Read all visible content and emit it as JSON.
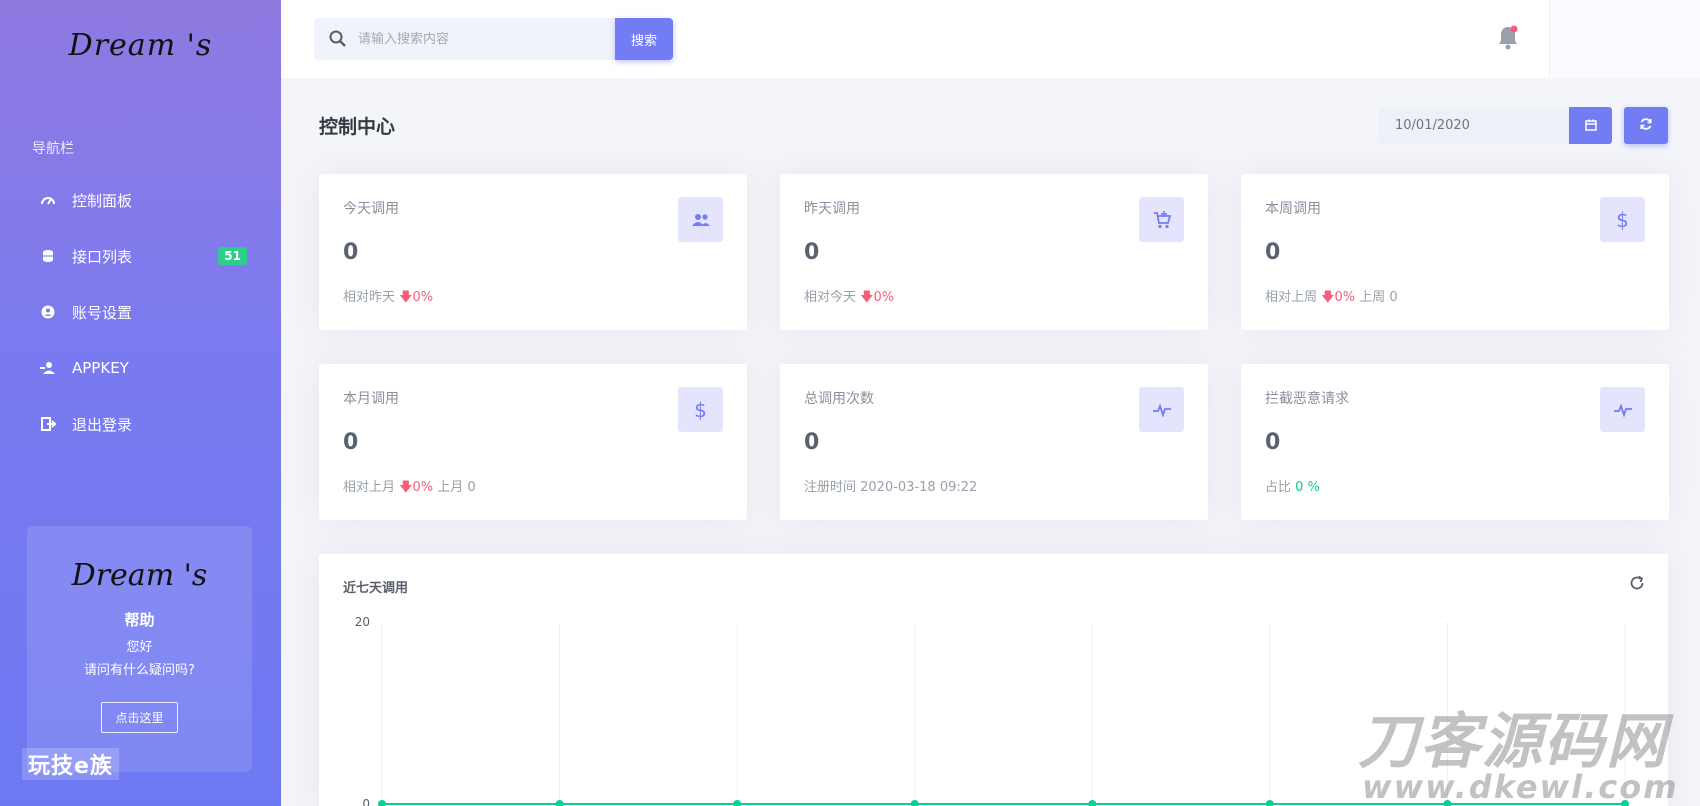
{
  "sidebar": {
    "logo": "Dream 's",
    "nav_title": "导航栏",
    "items": [
      {
        "label": "控制面板",
        "icon": "speedometer-icon"
      },
      {
        "label": "接口列表",
        "icon": "database-icon",
        "badge": "51"
      },
      {
        "label": "账号设置",
        "icon": "account-icon"
      },
      {
        "label": "APPKEY",
        "icon": "user-key-icon"
      },
      {
        "label": "退出登录",
        "icon": "logout-icon"
      }
    ],
    "help": {
      "logo": "Dream 's",
      "title": "帮助",
      "line1": "您好",
      "line2": "请问有什么疑问吗?",
      "button": "点击这里"
    },
    "watermark": "玩技e族"
  },
  "topbar": {
    "search_placeholder": "请输入搜索内容",
    "search_button": "搜索"
  },
  "main": {
    "title": "控制中心",
    "date_value": "10/01/2020",
    "cards": [
      {
        "label": "今天调用",
        "value": "0",
        "foot_prefix": "相对昨天",
        "change": "0%",
        "trend": "down",
        "foot_suffix": "",
        "icon": "users-icon"
      },
      {
        "label": "昨天调用",
        "value": "0",
        "foot_prefix": "相对今天",
        "change": "0%",
        "trend": "down",
        "foot_suffix": "",
        "icon": "cart-icon"
      },
      {
        "label": "本周调用",
        "value": "0",
        "foot_prefix": "相对上周",
        "change": "0%",
        "trend": "down",
        "foot_suffix": "上周 0",
        "icon": "dollar-icon"
      },
      {
        "label": "本月调用",
        "value": "0",
        "foot_prefix": "相对上月",
        "change": "0%",
        "trend": "down",
        "foot_suffix": "上月 0",
        "icon": "dollar-icon"
      },
      {
        "label": "总调用次数",
        "value": "0",
        "foot_prefix": "注册时间 2020-03-18 09:22",
        "change": "",
        "trend": "",
        "foot_suffix": "",
        "icon": "pulse-icon"
      },
      {
        "label": "拦截恶意请求",
        "value": "0",
        "foot_prefix": "占比",
        "change": "0 %",
        "trend": "up",
        "foot_suffix": "",
        "icon": "pulse-icon"
      }
    ],
    "chart_title": "近七天调用"
  },
  "watermark_right": {
    "line1": "刀客源码网",
    "line2": "www.dkewl.com"
  },
  "colors": {
    "primary": "#727cf5",
    "down": "#fa5c7c",
    "up": "#0acf97",
    "badge": "#2dce89"
  },
  "chart_data": {
    "type": "line",
    "title": "近七天调用",
    "y_ticks": [
      "20",
      "0"
    ],
    "ylim": [
      0,
      20
    ],
    "series": [
      {
        "values": [
          0,
          0,
          0,
          0,
          0,
          0,
          0,
          0
        ]
      }
    ],
    "grid": true
  }
}
